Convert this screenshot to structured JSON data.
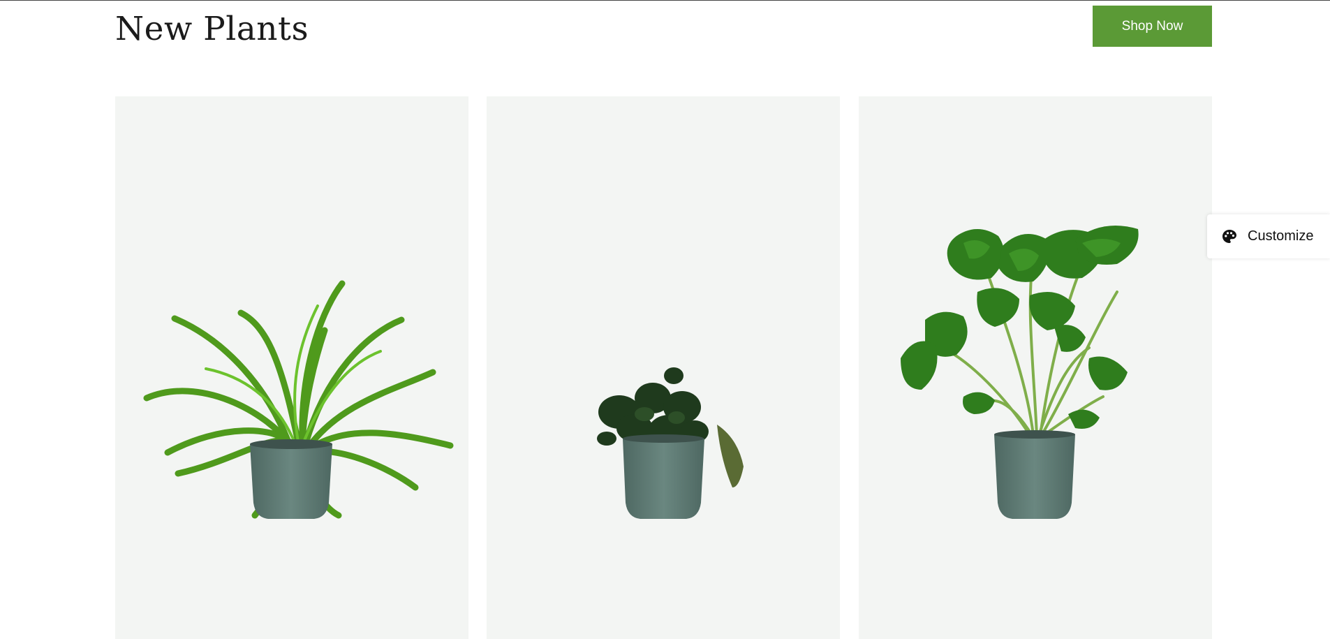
{
  "section": {
    "title": "New Plants",
    "shop_button_label": "Shop Now"
  },
  "products": [
    {
      "icon": "birds-nest-fern-image"
    },
    {
      "icon": "peperomia-image"
    },
    {
      "icon": "monstera-image"
    }
  ],
  "customize": {
    "label": "Customize",
    "icon": "palette-icon"
  },
  "colors": {
    "accent": "#5b9a36",
    "card_background": "#f3f5f3",
    "pot": "#5f7a74"
  }
}
